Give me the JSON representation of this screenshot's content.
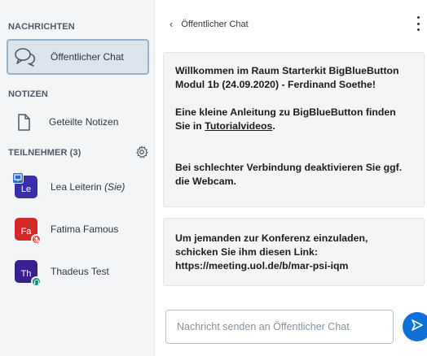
{
  "sidebar": {
    "messages_title": "NACHRICHTEN",
    "public_chat_label": "Öffentlicher Chat",
    "notes_title": "NOTIZEN",
    "shared_notes_label": "Geteilte Notizen",
    "participants_title": "TEILNEHMER (3)",
    "users": [
      {
        "initials": "Le",
        "name": "Lea Leiterin",
        "suffix": "(Sie)",
        "color": "#3a2fa8",
        "role": "presenter"
      },
      {
        "initials": "Fa",
        "name": "Fatima Famous",
        "suffix": "",
        "color": "#d42828",
        "status_color": "#e5473b",
        "status_icon": "muted-mic-icon"
      },
      {
        "initials": "Th",
        "name": "Thadeus Test",
        "suffix": "",
        "color": "#3a1f8f",
        "status_color": "#0d8a74",
        "status_icon": "headphones-icon"
      }
    ]
  },
  "chat": {
    "back_label": "Öffentlicher Chat",
    "welcome": {
      "line1a": "Willkommen im Raum ",
      "line1b": "Starterkit BigBlueButton",
      "line2": "Modul 1b (24.09.2020) - Ferdinand Soethe!",
      "tutorial_a": "Eine kleine Anleitung zu BigBlueButton finden",
      "tutorial_b": "Sie in ",
      "tutorial_link": "Tutorialvideos",
      "tutorial_c": ".",
      "webcam_a": "Bei schlechter Verbindung deaktivieren Sie ggf.",
      "webcam_b": "die Webcam."
    },
    "invite": {
      "line1": "Um jemanden zur Konferenz einzuladen,",
      "line2": "schicken Sie ihm diesen Link:",
      "line3": "https://meeting.uol.de/b/mar-psi-iqm"
    },
    "input_placeholder": "Nachricht senden an Öffentlicher Chat"
  },
  "colors": {
    "accent": "#0f70d7",
    "sidebar_bg": "#f3f5f7",
    "active_item_bg": "#dce4ed"
  }
}
